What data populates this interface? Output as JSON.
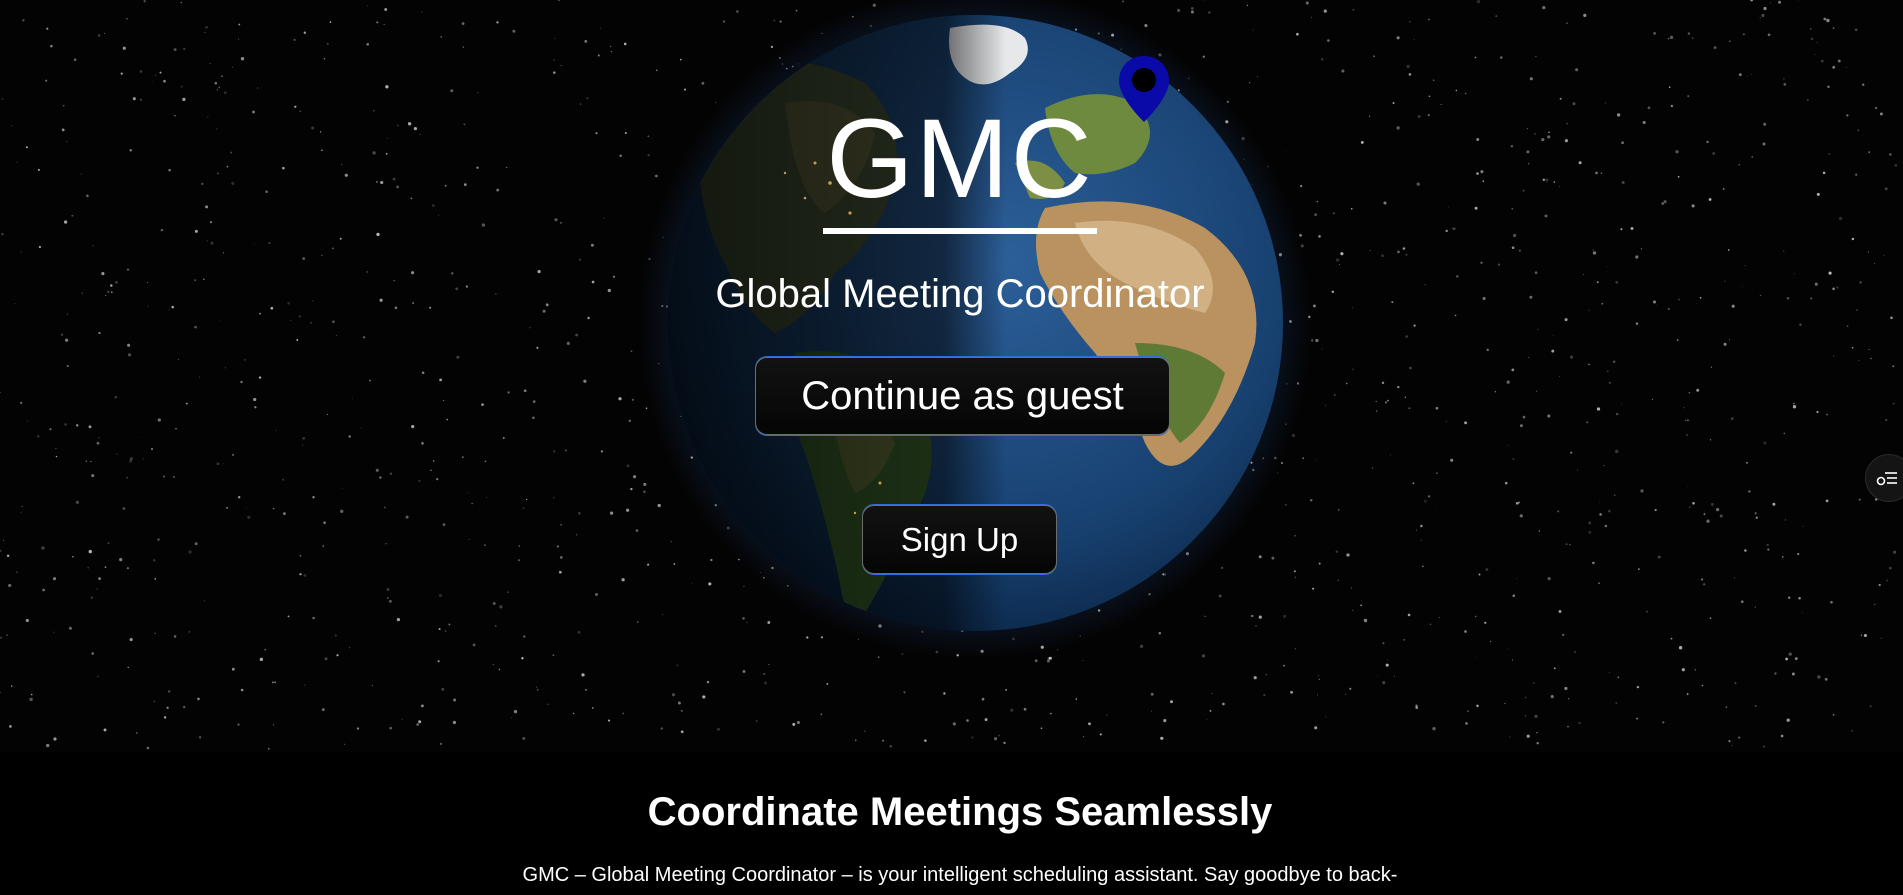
{
  "hero": {
    "logo_text": "GMC",
    "subtitle": "Global Meeting Coordinator",
    "guest_button_label": "Continue as guest",
    "signup_button_label": "Sign Up"
  },
  "icons": {
    "location_pin": "map-pin-icon",
    "side_widget": "settings-list-icon",
    "globe": "earth-globe"
  },
  "colors": {
    "background": "#000000",
    "pin": "#0a0aa8",
    "button_accent": "#2f6ddb",
    "text": "#ffffff"
  },
  "about": {
    "heading": "Coordinate Meetings Seamlessly",
    "text": "GMC – Global Meeting Coordinator – is your intelligent scheduling assistant. Say goodbye to back-"
  }
}
